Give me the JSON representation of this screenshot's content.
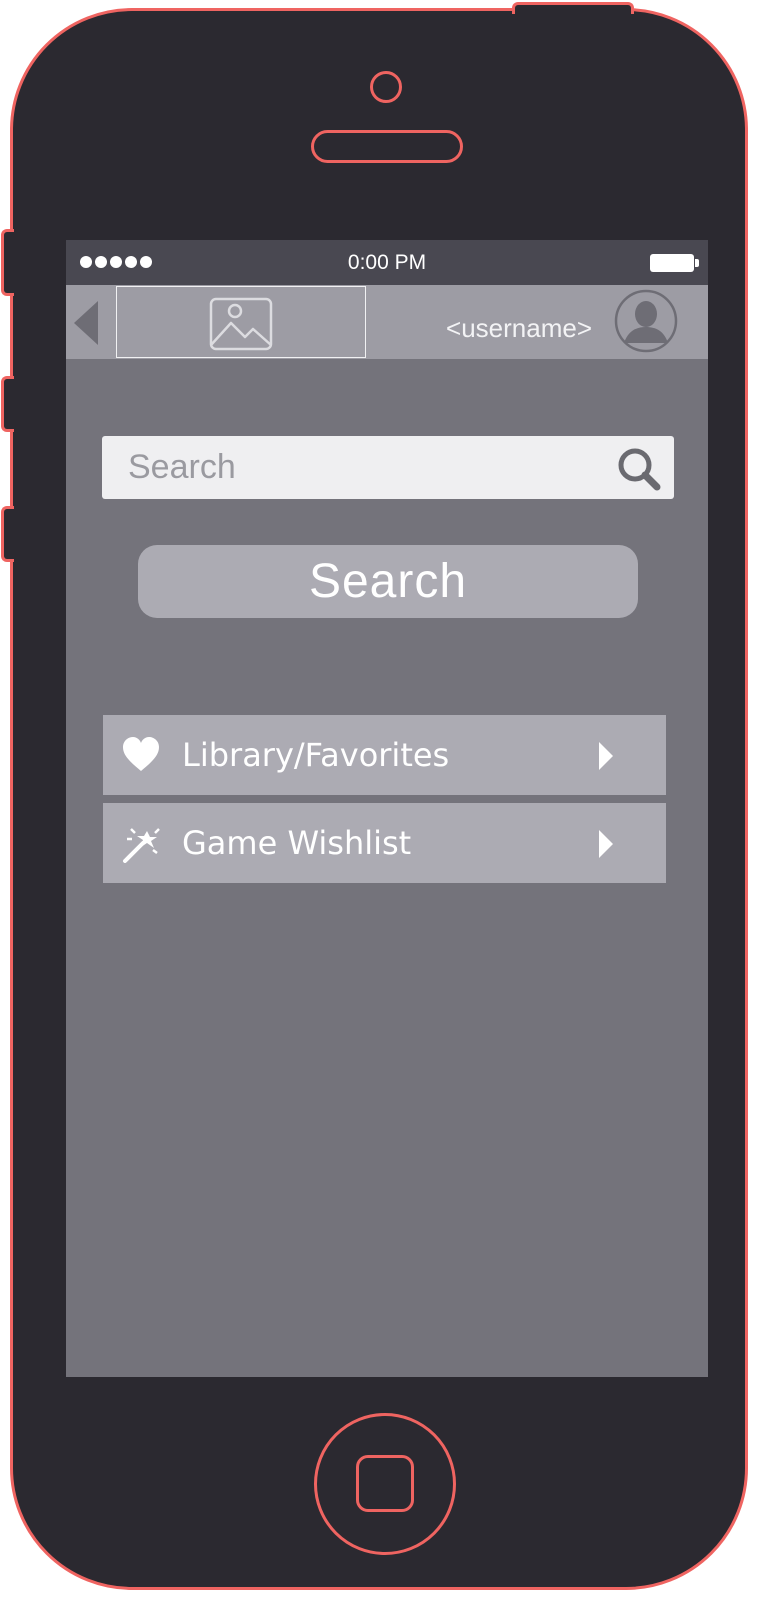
{
  "status_bar": {
    "time": "0:00 PM",
    "signal_dots": 5
  },
  "header": {
    "username": "<username>"
  },
  "search": {
    "placeholder": "Search",
    "button_label": "Search"
  },
  "menu": {
    "items": [
      {
        "label": "Library/Favorites",
        "icon": "heart-icon"
      },
      {
        "label": "Game Wishlist",
        "icon": "magic-wand-icon"
      }
    ]
  },
  "colors": {
    "phone_outline": "#ef6461",
    "phone_body": "#2b2930",
    "screen_bg": "#74737b",
    "status_bar_bg": "#494851",
    "nav_bar_bg": "#9d9ca4",
    "button_bg": "#acabb3"
  }
}
